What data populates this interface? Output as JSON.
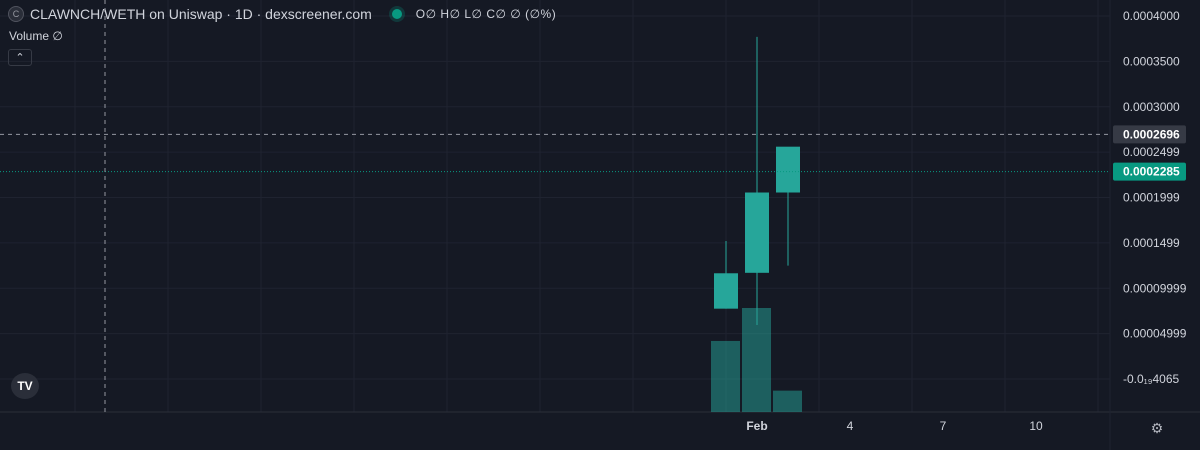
{
  "header": {
    "symbol_icon": "C",
    "title": "CLAWNCH/WETH on Uniswap · 1D · dexscreener.com",
    "ohlc": "O∅ H∅ L∅ C∅ ∅ (∅%)",
    "status_color": "#089981"
  },
  "volume_label": "Volume  ∅",
  "collapse_button": "chevron-up-icon",
  "logo": "TV",
  "crosshair_price": "0.0002696",
  "last_price": "0.0002285",
  "colors": {
    "background": "#151924",
    "grid": "#1f2330",
    "up": "#26a69a",
    "volume": "rgba(38,166,154,0.5)",
    "last_price_tag": "#089981",
    "crosshair_tag": "#363a45"
  },
  "chart_data": {
    "type": "candlestick",
    "y_ticks": [
      {
        "value": 0.0004,
        "label": "0.0004000"
      },
      {
        "value": 0.00035,
        "label": "0.0003500"
      },
      {
        "value": 0.0003,
        "label": "0.0003000"
      },
      {
        "value": 0.00025,
        "label": "0.0002499"
      },
      {
        "value": 0.0002,
        "label": "0.0001999"
      },
      {
        "value": 0.00015,
        "label": "0.0001499"
      },
      {
        "value": 0.0001,
        "label": "0.00009999"
      },
      {
        "value": 5e-05,
        "label": "0.00004999"
      },
      {
        "value": 0.0,
        "label": "-0.0₁₉4065"
      }
    ],
    "x_ticks": [
      {
        "day": 0,
        "label": "Feb"
      },
      {
        "day": 3,
        "label": "4"
      },
      {
        "day": 6,
        "label": "7"
      },
      {
        "day": 9,
        "label": "10"
      }
    ],
    "candles": [
      {
        "day": -1,
        "open": 7.75e-05,
        "high": 0.000152,
        "low": 7.75e-05,
        "close": 7.75e-05,
        "body_top": 0.0001165,
        "volume": 7.65e-05
      },
      {
        "day": 0,
        "open": 0.000117,
        "high": 0.000377,
        "low": 5.95e-05,
        "close": 0.0002055,
        "volume": 0.000112
      },
      {
        "day": 1,
        "open": 0.0002055,
        "high": 0.000218,
        "low": 0.000125,
        "close": 0.000256,
        "volume": 2.3e-05
      }
    ],
    "ylim": [
      -3.7e-06,
      0.000411
    ]
  }
}
